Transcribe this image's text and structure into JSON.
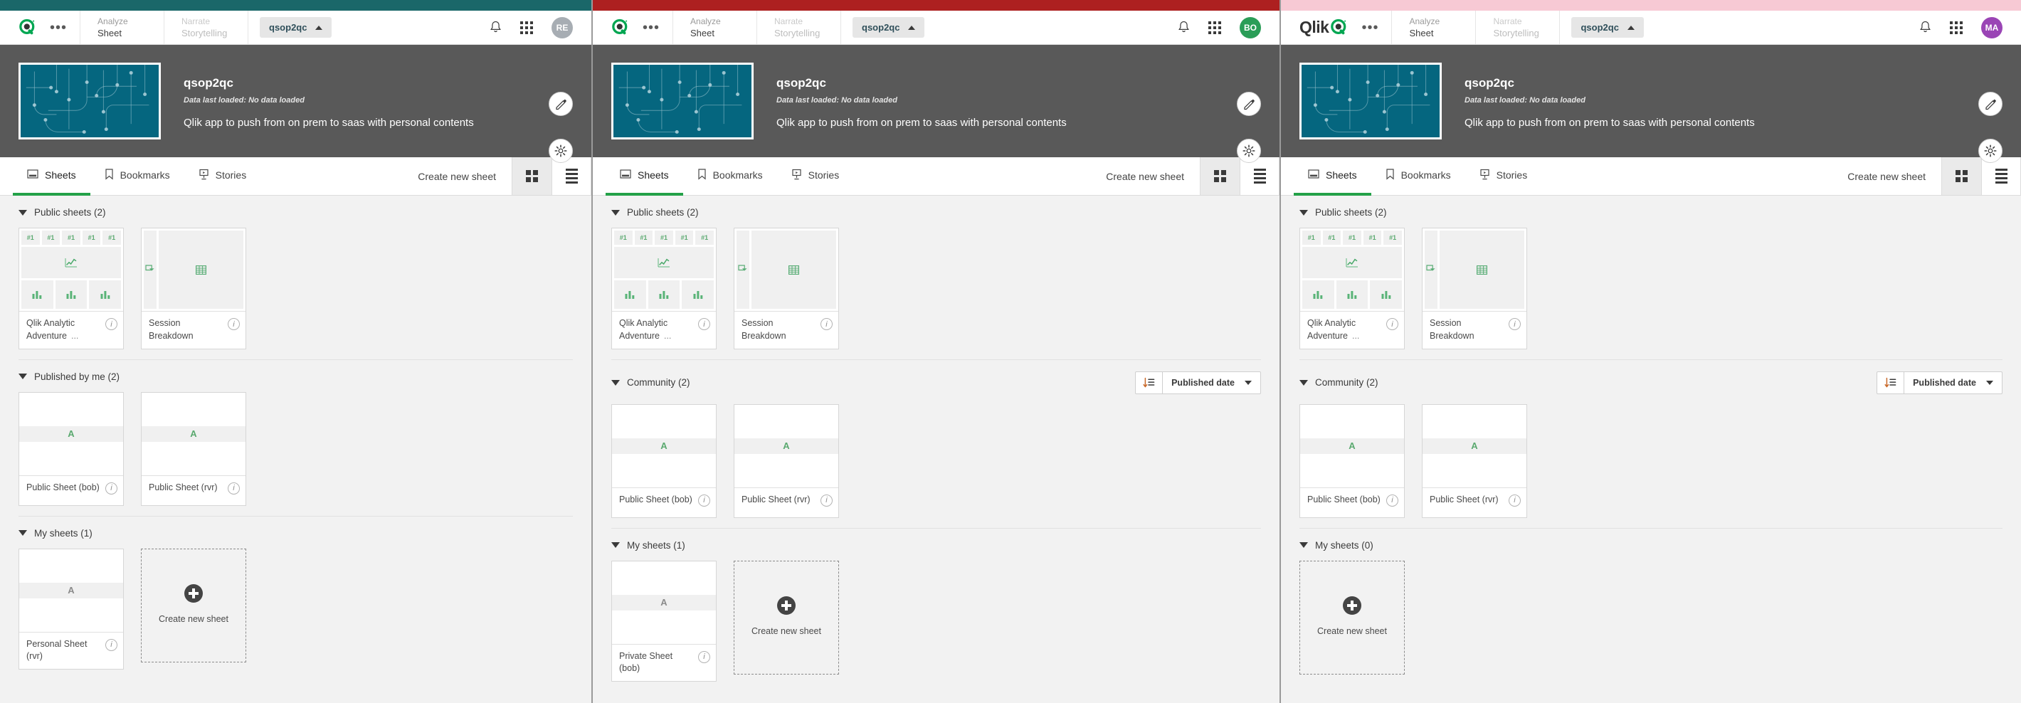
{
  "panels": [
    {
      "id": "panel-1",
      "accent_color": "#1a6769",
      "logo_kind": "mark",
      "logo_text": "",
      "nav": [
        {
          "top": "Analyze",
          "bottom": "Sheet",
          "dim": false
        },
        {
          "top": "Narrate",
          "bottom": "Storytelling",
          "dim": true
        }
      ],
      "app_selector": "qsop2qc",
      "avatar": {
        "initials": "RE",
        "color": "#a7adb3"
      },
      "app": {
        "title": "qsop2qc",
        "subtitle": "Data last loaded: No data loaded",
        "description": "Qlik app to push from on prem to saas with personal contents"
      },
      "tabs": [
        {
          "label": "Sheets",
          "icon": "sheet-icon",
          "active": true
        },
        {
          "label": "Bookmarks",
          "icon": "bookmark-icon",
          "active": false
        },
        {
          "label": "Stories",
          "icon": "story-icon",
          "active": false
        }
      ],
      "create_new_sheet": "Create new sheet",
      "view_modes": [
        {
          "name": "grid-view",
          "active": true
        },
        {
          "name": "list-view",
          "active": false
        }
      ],
      "sort": null,
      "sections": [
        {
          "title": "Public sheets (2)",
          "sort": null,
          "cards": [
            {
              "name": "Qlik Analytic Adventure",
              "ellipsis": "...",
              "thumb": "dashboard",
              "kind": "sheet"
            },
            {
              "name": "Session Breakdown",
              "ellipsis": "",
              "thumb": "table",
              "kind": "sheet"
            }
          ]
        },
        {
          "title": "Published by me (2)",
          "sort": null,
          "cards": [
            {
              "name": "Public Sheet (bob)",
              "ellipsis": "",
              "thumb": "band-green",
              "kind": "sheet"
            },
            {
              "name": "Public Sheet (rvr)",
              "ellipsis": "",
              "thumb": "band-green",
              "kind": "sheet"
            }
          ]
        },
        {
          "title": "My sheets (1)",
          "sort": null,
          "cards": [
            {
              "name": "Personal Sheet (rvr)",
              "ellipsis": "",
              "thumb": "band-grey",
              "kind": "sheet"
            },
            {
              "name": "Create new sheet",
              "ellipsis": "",
              "thumb": "",
              "kind": "new"
            }
          ]
        }
      ]
    },
    {
      "id": "panel-2",
      "accent_color": "#ad2020",
      "logo_kind": "mark",
      "logo_text": "",
      "nav": [
        {
          "top": "Analyze",
          "bottom": "Sheet",
          "dim": false
        },
        {
          "top": "Narrate",
          "bottom": "Storytelling",
          "dim": true
        }
      ],
      "app_selector": "qsop2qc",
      "avatar": {
        "initials": "BO",
        "color": "#2a9d57"
      },
      "app": {
        "title": "qsop2qc",
        "subtitle": "Data last loaded: No data loaded",
        "description": "Qlik app to push from on prem to saas with personal contents"
      },
      "tabs": [
        {
          "label": "Sheets",
          "icon": "sheet-icon",
          "active": true
        },
        {
          "label": "Bookmarks",
          "icon": "bookmark-icon",
          "active": false
        },
        {
          "label": "Stories",
          "icon": "story-icon",
          "active": false
        }
      ],
      "create_new_sheet": "Create new sheet",
      "view_modes": [
        {
          "name": "grid-view",
          "active": true
        },
        {
          "name": "list-view",
          "active": false
        }
      ],
      "sort": {
        "value": "Published date"
      },
      "sections": [
        {
          "title": "Public sheets (2)",
          "sort": null,
          "cards": [
            {
              "name": "Qlik Analytic Adventure",
              "ellipsis": "...",
              "thumb": "dashboard",
              "kind": "sheet"
            },
            {
              "name": "Session Breakdown",
              "ellipsis": "",
              "thumb": "table",
              "kind": "sheet"
            }
          ]
        },
        {
          "title": "Community (2)",
          "sort": {
            "value": "Published date"
          },
          "cards": [
            {
              "name": "Public Sheet (bob)",
              "ellipsis": "",
              "thumb": "band-green",
              "kind": "sheet"
            },
            {
              "name": "Public Sheet (rvr)",
              "ellipsis": "",
              "thumb": "band-green",
              "kind": "sheet"
            }
          ]
        },
        {
          "title": "My sheets (1)",
          "sort": null,
          "cards": [
            {
              "name": "Private Sheet (bob)",
              "ellipsis": "",
              "thumb": "band-grey",
              "kind": "sheet"
            },
            {
              "name": "Create new sheet",
              "ellipsis": "",
              "thumb": "",
              "kind": "new"
            }
          ]
        }
      ]
    },
    {
      "id": "panel-3",
      "accent_color": "#f7c9d4",
      "logo_kind": "wordmark",
      "logo_text": "Qlik",
      "nav": [
        {
          "top": "Analyze",
          "bottom": "Sheet",
          "dim": false
        },
        {
          "top": "Narrate",
          "bottom": "Storytelling",
          "dim": true
        }
      ],
      "app_selector": "qsop2qc",
      "avatar": {
        "initials": "MA",
        "color": "#9a45b5"
      },
      "app": {
        "title": "qsop2qc",
        "subtitle": "Data last loaded: No data loaded",
        "description": "Qlik app to push from on prem to saas with personal contents"
      },
      "tabs": [
        {
          "label": "Sheets",
          "icon": "sheet-icon",
          "active": true
        },
        {
          "label": "Bookmarks",
          "icon": "bookmark-icon",
          "active": false
        },
        {
          "label": "Stories",
          "icon": "story-icon",
          "active": false
        }
      ],
      "create_new_sheet": "Create new sheet",
      "view_modes": [
        {
          "name": "grid-view",
          "active": true
        },
        {
          "name": "list-view",
          "active": false
        }
      ],
      "sort": {
        "value": "Published date"
      },
      "sections": [
        {
          "title": "Public sheets (2)",
          "sort": null,
          "cards": [
            {
              "name": "Qlik Analytic Adventure",
              "ellipsis": "...",
              "thumb": "dashboard",
              "kind": "sheet"
            },
            {
              "name": "Session Breakdown",
              "ellipsis": "",
              "thumb": "table",
              "kind": "sheet"
            }
          ]
        },
        {
          "title": "Community (2)",
          "sort": {
            "value": "Published date"
          },
          "cards": [
            {
              "name": "Public Sheet (bob)",
              "ellipsis": "",
              "thumb": "band-green",
              "kind": "sheet"
            },
            {
              "name": "Public Sheet (rvr)",
              "ellipsis": "",
              "thumb": "band-green",
              "kind": "sheet"
            }
          ]
        },
        {
          "title": "My sheets (0)",
          "sort": null,
          "cards": [
            {
              "name": "Create new sheet",
              "ellipsis": "",
              "thumb": "",
              "kind": "new"
            }
          ]
        }
      ]
    }
  ],
  "glyphs": {
    "kpi_badge": "#1",
    "info": "i",
    "dots": "•••"
  }
}
